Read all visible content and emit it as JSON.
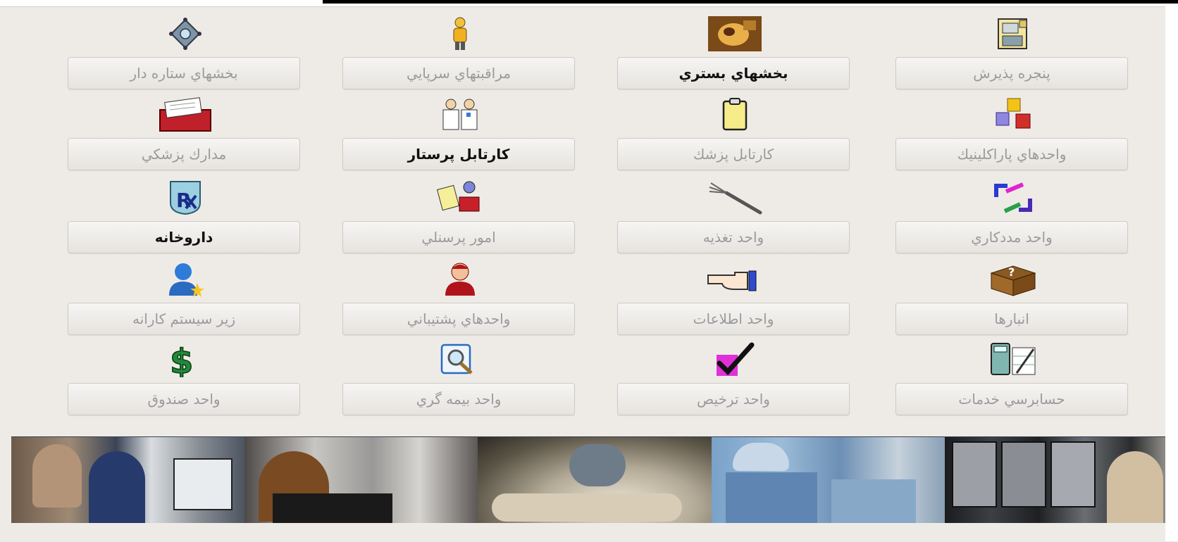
{
  "buttons": {
    "r1c1": "بخشهاي ستاره دار",
    "r1c2": "مراقبتهاي سرپايي",
    "r1c3": "بخشهاي بستري",
    "r1c4": "پنجره پذيرش",
    "r2c1": "مدارك پزشكي",
    "r2c2": "كارتابل پرستار",
    "r2c3": "كارتابل پزشك",
    "r2c4": "واحدهاي پاراكلينيك",
    "r3c1": "داروخانه",
    "r3c2": "امور پرسنلي",
    "r3c3": "واحد تغذيه",
    "r3c4": "واحد مددكاري",
    "r4c1": "زير سيستم كارانه",
    "r4c2": "واحدهاي پشتيباني",
    "r4c3": "واحد اطلاعات",
    "r4c4": "انبارها",
    "r5c1": "واحد صندوق",
    "r5c2": "واحد بيمه گري",
    "r5c3": "واحد ترخيص",
    "r5c4": "حسابرسي خدمات"
  },
  "icons": {
    "r1c1": "star-ornament-icon",
    "r1c2": "person-icon",
    "r1c3": "photo-icon",
    "r1c4": "cash-register-icon",
    "r2c1": "card-file-icon",
    "r2c2": "medical-staff-icon",
    "r2c3": "clipboard-icon",
    "r2c4": "cubes-icon",
    "r3c1": "rx-pharmacy-icon",
    "r3c2": "personnel-icon",
    "r3c3": "fork-icon",
    "r3c4": "arrows-exchange-icon",
    "r4c1": "user-star-icon",
    "r4c2": "user-red-icon",
    "r4c3": "pointing-hand-icon",
    "r4c4": "question-box-icon",
    "r5c1": "dollar-icon",
    "r5c2": "magnifier-icon",
    "r5c3": "checkmark-icon",
    "r5c4": "calculator-icon"
  },
  "colors": {
    "panel_bg": "#eeebe7",
    "enabled_text": "#111111",
    "disabled_text": "#9a9a9a"
  }
}
